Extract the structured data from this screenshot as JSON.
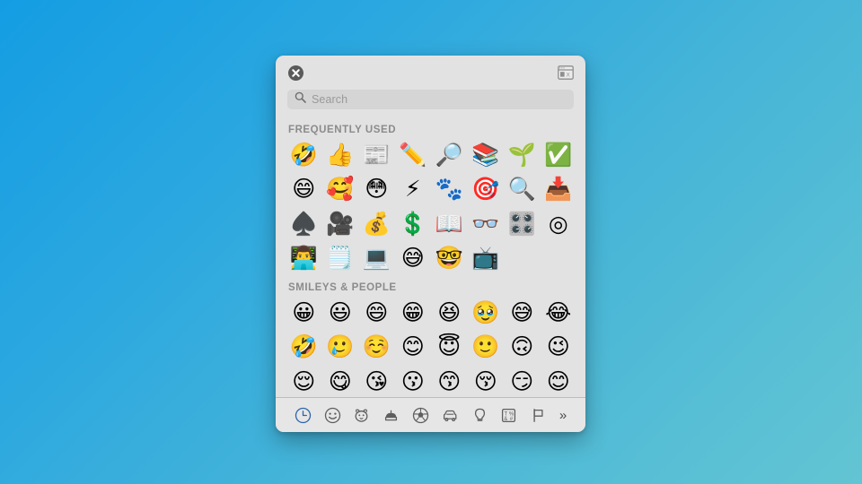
{
  "panel": {
    "close_label": "Close",
    "character_viewer_label": "Character Viewer"
  },
  "search": {
    "placeholder": "Search",
    "value": "",
    "icon": "search-icon"
  },
  "sections": [
    {
      "id": "frequently-used",
      "title": "FREQUENTLY USED",
      "emoji": [
        "🤣",
        "👍",
        "📰",
        "✏️",
        "🔎",
        "📚",
        "🌱",
        "✅",
        "😄",
        "🥰",
        "😳",
        "⚡",
        "🐾",
        "🎯",
        "🔍",
        "📥",
        "♠️",
        "🎥",
        "💰",
        "💲",
        "📖",
        "👓",
        "🎛️",
        "◎",
        "👨‍💻",
        "🗒️",
        "💻",
        "😅",
        "🤓",
        "📺"
      ]
    },
    {
      "id": "smileys-and-people",
      "title": "SMILEYS & PEOPLE",
      "emoji": [
        "😀",
        "😃",
        "😄",
        "😁",
        "😆",
        "🥹",
        "😅",
        "😂",
        "🤣",
        "🥲",
        "☺️",
        "😊",
        "😇",
        "🙂",
        "🙃",
        "😉",
        "😌",
        "😋",
        "😘",
        "😗",
        "😙",
        "😚",
        "😏",
        "😊"
      ]
    }
  ],
  "toolbar": {
    "categories": [
      {
        "id": "frequently-used",
        "icon": "clock-icon",
        "label": "Frequently Used",
        "selected": true
      },
      {
        "id": "smileys-people",
        "icon": "smiley-icon",
        "label": "Smileys & People",
        "selected": false
      },
      {
        "id": "animals-nature",
        "icon": "animal-icon",
        "label": "Animals & Nature",
        "selected": false
      },
      {
        "id": "food-drink",
        "icon": "food-icon",
        "label": "Food & Drink",
        "selected": false
      },
      {
        "id": "activity",
        "icon": "ball-icon",
        "label": "Activity",
        "selected": false
      },
      {
        "id": "travel-places",
        "icon": "car-icon",
        "label": "Travel & Places",
        "selected": false
      },
      {
        "id": "objects",
        "icon": "lightbulb-icon",
        "label": "Objects",
        "selected": false
      },
      {
        "id": "symbols",
        "icon": "symbols-icon",
        "label": "Symbols",
        "selected": false
      },
      {
        "id": "flags",
        "icon": "flag-icon",
        "label": "Flags",
        "selected": false
      }
    ],
    "more_label": "»"
  }
}
